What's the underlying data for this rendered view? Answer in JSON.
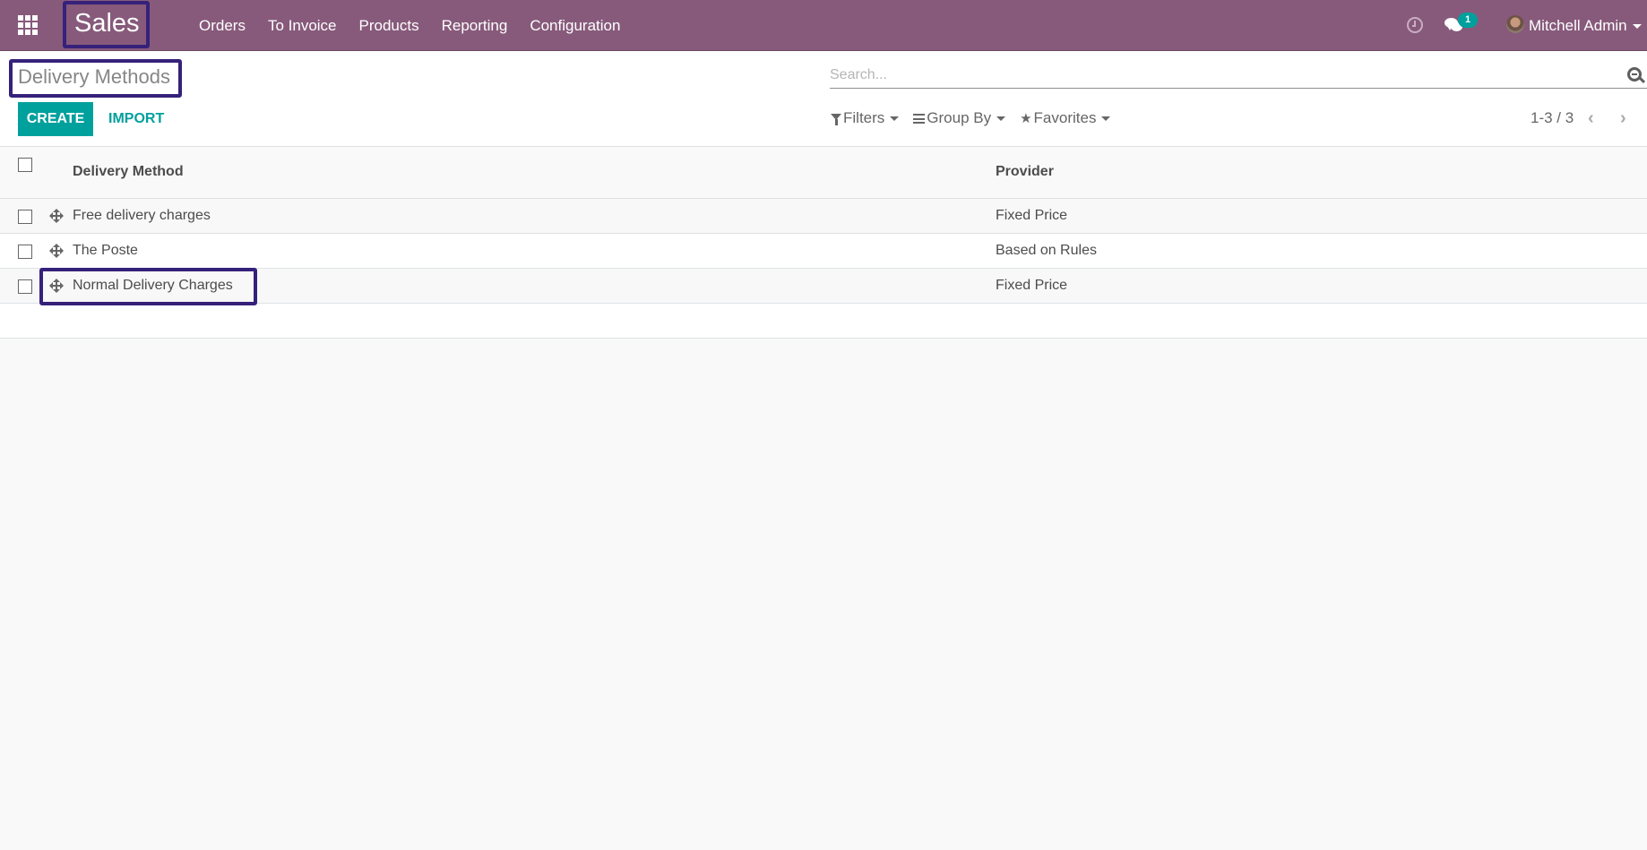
{
  "navbar": {
    "app_name": "Sales",
    "menu": [
      "Orders",
      "To Invoice",
      "Products",
      "Reporting",
      "Configuration"
    ],
    "icons": {
      "apps": "apps-grid-icon",
      "activity": "clock-icon",
      "messages": "chat-icon"
    },
    "message_count": "1",
    "user_name": "Mitchell Admin",
    "colors": {
      "brand": "#875a7b",
      "accent": "#00a09d",
      "highlight_box": "#36217a"
    }
  },
  "control_panel": {
    "title": "Delivery Methods",
    "create_label": "CREATE",
    "import_label": "IMPORT",
    "search_placeholder": "Search...",
    "search_value": "",
    "filters_label": "Filters",
    "group_by_label": "Group By",
    "favorites_label": "Favorites",
    "pager": "1-3 / 3",
    "prev_glyph": "‹",
    "next_glyph": "›"
  },
  "table": {
    "columns": [
      "Delivery Method",
      "Provider"
    ],
    "rows": [
      {
        "name": "Free delivery charges",
        "provider": "Fixed Price"
      },
      {
        "name": "The Poste",
        "provider": "Based on Rules"
      },
      {
        "name": "Normal Delivery Charges",
        "provider": "Fixed Price"
      }
    ]
  }
}
